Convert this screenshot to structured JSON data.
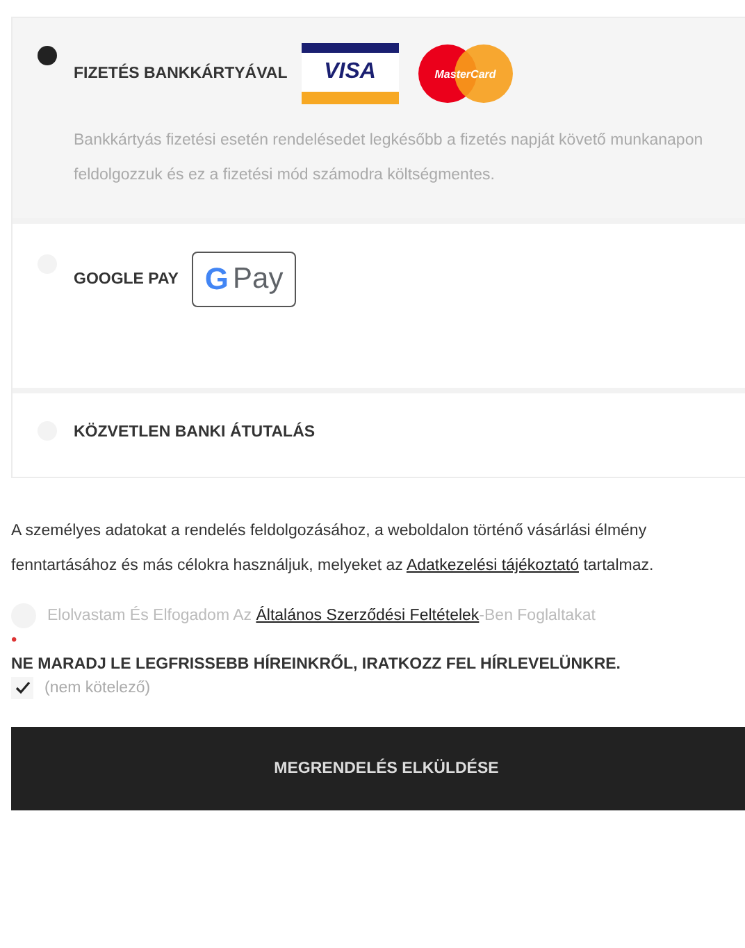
{
  "payment_methods": [
    {
      "kind": "card",
      "label": "FIZETÉS BANKKÁRTYÁVAL",
      "selected": true,
      "visa": "VISA",
      "mastercard": "MasterCard",
      "description": "Bankkártyás fizetési esetén rendelésedet legkésőbb a fizetés napját követő munkanapon feldolgozzuk és ez a fizetési mód számodra költségmentes."
    },
    {
      "kind": "gpay",
      "label": "GOOGLE PAY",
      "selected": false,
      "badge_letter": "G",
      "badge_text": "Pay"
    },
    {
      "kind": "plain",
      "label": "KÖZVETLEN BANKI ÁTUTALÁS",
      "selected": false
    }
  ],
  "privacy": {
    "text": "A személyes adatokat a rendelés feldolgozásához, a weboldalon történő vásárlási élmény fenntartásához és más célokra használjuk, melyeket az",
    "link": "Adatkezelési tájékoztató",
    "after": "tartalmaz."
  },
  "terms": {
    "checked": false,
    "before": "Elolvastam És Elfogadom Az",
    "link": "Általános Szerződési Feltételek",
    "after": "-Ben Foglaltakat",
    "required_mark": "•"
  },
  "newsletter": {
    "title": "NE MARADJ LE LEGFRISSEBB HÍREINKRŐL, IRATKOZZ FEL HÍRLEVELÜNKRE.",
    "checked": true,
    "note": "(nem kötelező)"
  },
  "submit": "MEGRENDELÉS ELKÜLDÉSE"
}
